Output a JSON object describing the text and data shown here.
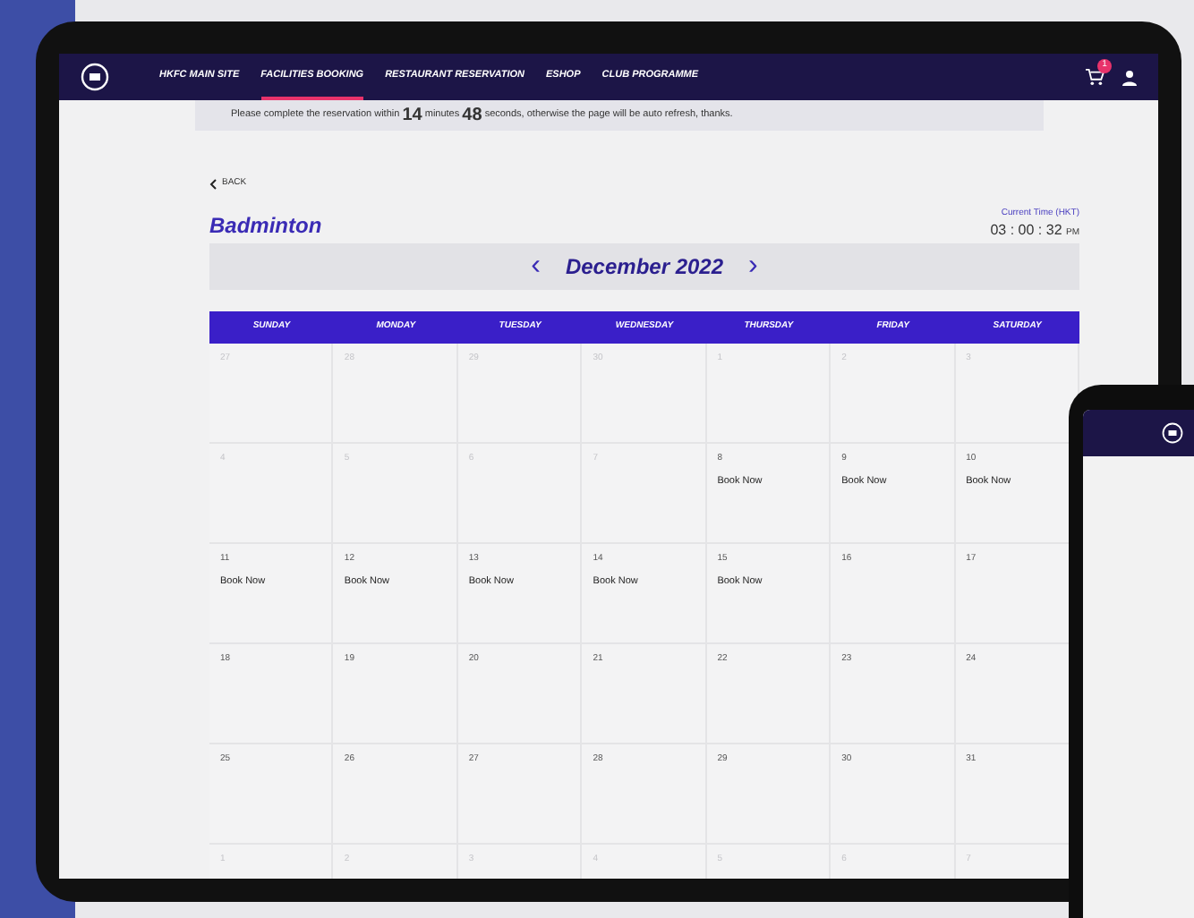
{
  "nav": {
    "items": [
      {
        "label": "HKFC MAIN SITE",
        "selected": false
      },
      {
        "label": "FACILITIES BOOKING",
        "selected": true
      },
      {
        "label": "RESTAURANT RESERVATION",
        "selected": false
      },
      {
        "label": "ESHOP",
        "selected": false
      },
      {
        "label": "CLUB PROGRAMME",
        "selected": false
      }
    ],
    "cart_count": "1"
  },
  "notice": {
    "before": "Please complete the reservation within",
    "minutes": "14",
    "minutes_label": "minutes",
    "seconds": "48",
    "after": "seconds, otherwise the page will be auto refresh, thanks."
  },
  "back": "BACK",
  "title": "Badminton",
  "clock": {
    "label": "Current Time (HKT)",
    "time": "03 : 00 : 32",
    "ampm": "PM"
  },
  "month": {
    "prev": "‹",
    "label": "December 2022",
    "next": "›"
  },
  "weekdays": [
    "SUNDAY",
    "MONDAY",
    "TUESDAY",
    "WEDNESDAY",
    "THURSDAY",
    "FRIDAY",
    "SATURDAY"
  ],
  "weeks": [
    [
      {
        "day": "27",
        "muted": true
      },
      {
        "day": "28",
        "muted": true
      },
      {
        "day": "29",
        "muted": true
      },
      {
        "day": "30",
        "muted": true
      },
      {
        "day": "1",
        "muted": true
      },
      {
        "day": "2",
        "muted": true
      },
      {
        "day": "3",
        "muted": true
      }
    ],
    [
      {
        "day": "4",
        "muted": true
      },
      {
        "day": "5",
        "muted": true
      },
      {
        "day": "6",
        "muted": true
      },
      {
        "day": "7",
        "muted": true
      },
      {
        "day": "8",
        "muted": false,
        "action": "Book Now"
      },
      {
        "day": "9",
        "muted": false,
        "action": "Book Now"
      },
      {
        "day": "10",
        "muted": false,
        "action": "Book Now"
      }
    ],
    [
      {
        "day": "11",
        "muted": false,
        "action": "Book Now"
      },
      {
        "day": "12",
        "muted": false,
        "action": "Book Now"
      },
      {
        "day": "13",
        "muted": false,
        "action": "Book Now"
      },
      {
        "day": "14",
        "muted": false,
        "action": "Book Now"
      },
      {
        "day": "15",
        "muted": false,
        "action": "Book Now"
      },
      {
        "day": "16",
        "muted": false
      },
      {
        "day": "17",
        "muted": false
      }
    ],
    [
      {
        "day": "18",
        "muted": false
      },
      {
        "day": "19",
        "muted": false
      },
      {
        "day": "20",
        "muted": false
      },
      {
        "day": "21",
        "muted": false
      },
      {
        "day": "22",
        "muted": false
      },
      {
        "day": "23",
        "muted": false
      },
      {
        "day": "24",
        "muted": false
      }
    ],
    [
      {
        "day": "25",
        "muted": false
      },
      {
        "day": "26",
        "muted": false
      },
      {
        "day": "27",
        "muted": false
      },
      {
        "day": "28",
        "muted": false
      },
      {
        "day": "29",
        "muted": false
      },
      {
        "day": "30",
        "muted": false
      },
      {
        "day": "31",
        "muted": false
      }
    ],
    [
      {
        "day": "1",
        "muted": true
      },
      {
        "day": "2",
        "muted": true
      },
      {
        "day": "3",
        "muted": true
      },
      {
        "day": "4",
        "muted": true
      },
      {
        "day": "5",
        "muted": true
      },
      {
        "day": "6",
        "muted": true
      },
      {
        "day": "7",
        "muted": true
      }
    ]
  ]
}
